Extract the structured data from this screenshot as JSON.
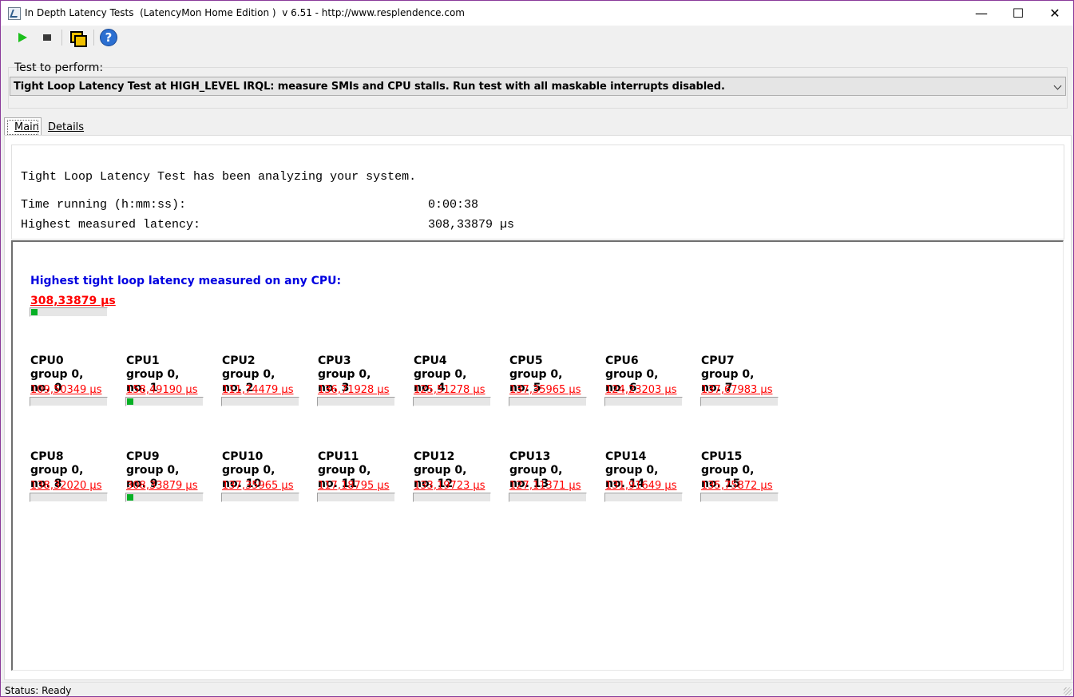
{
  "window": {
    "title": "In Depth Latency Tests  (LatencyMon Home Edition )  v 6.51 - http://www.resplendence.com",
    "minimize": "—",
    "maximize": "☐",
    "close": "✕"
  },
  "toolbar": {
    "play_icon": "play-icon",
    "stop_icon": "stop-icon",
    "windows_icon": "windows-icon",
    "help_icon": "help-icon",
    "help_glyph": "?"
  },
  "test": {
    "label": "Test to perform:",
    "selected": "Tight Loop Latency Test at HIGH_LEVEL IRQL:  measure SMIs and CPU stalls. Run test with all maskable interrupts disabled."
  },
  "tabs": [
    {
      "label": "Main",
      "active": true
    },
    {
      "label": "Details",
      "active": false
    }
  ],
  "summary": {
    "line1": "Tight Loop Latency Test has been analyzing your system.",
    "time_label": "Time running (h:mm:ss):",
    "time_value": "0:00:38",
    "latency_label": "Highest measured latency:",
    "latency_value": "308,33879 µs"
  },
  "highest": {
    "title": "Highest tight loop latency measured on any CPU:",
    "value": "308,33879 µs",
    "level": 0.08
  },
  "cpus": [
    {
      "name": "CPU0\ngroup 0,\nno. 0",
      "value": "109,50349 µs",
      "level": 0
    },
    {
      "name": "CPU1\ngroup 0,\nno. 1",
      "value": "158,49190 µs",
      "level": 0.08
    },
    {
      "name": "CPU2\ngroup 0,\nno. 2",
      "value": "111,74479 µs",
      "level": 0
    },
    {
      "name": "CPU3\ngroup 0,\nno. 3",
      "value": "136,71928 µs",
      "level": 0
    },
    {
      "name": "CPU4\ngroup 0,\nno. 4",
      "value": "125,51278 µs",
      "level": 0
    },
    {
      "name": "CPU5\ngroup 0,\nno. 5",
      "value": "137,35965 µs",
      "level": 0
    },
    {
      "name": "CPU6\ngroup 0,\nno. 6",
      "value": "124,23203 µs",
      "level": 0
    },
    {
      "name": "CPU7\ngroup 0,\nno. 7",
      "value": "137,67983 µs",
      "level": 0
    },
    {
      "name": "CPU8\ngroup 0,\nno. 8",
      "value": "138,32020 µs",
      "level": 0
    },
    {
      "name": "CPU9\ngroup 0,\nno. 9",
      "value": "308,33879 µs",
      "level": 0.08
    },
    {
      "name": "CPU10\ngroup 0,\nno. 10",
      "value": "137,35965 µs",
      "level": 0
    },
    {
      "name": "CPU11\ngroup 0,\nno. 11",
      "value": "117,18795 µs",
      "level": 0
    },
    {
      "name": "CPU12\ngroup 0,\nno. 12",
      "value": "133,19723 µs",
      "level": 0
    },
    {
      "name": "CPU13\ngroup 0,\nno. 13",
      "value": "127,11371 µs",
      "level": 0
    },
    {
      "name": "CPU14\ngroup 0,\nno. 14",
      "value": "131,91649 µs",
      "level": 0
    },
    {
      "name": "CPU15\ngroup 0,\nno. 15",
      "value": "135,75872 µs",
      "level": 0
    }
  ],
  "status": {
    "text": "Status: Ready"
  },
  "colors": {
    "accent_red": "#ff0000",
    "accent_blue": "#0000e0",
    "bar_green": "#06b025"
  }
}
